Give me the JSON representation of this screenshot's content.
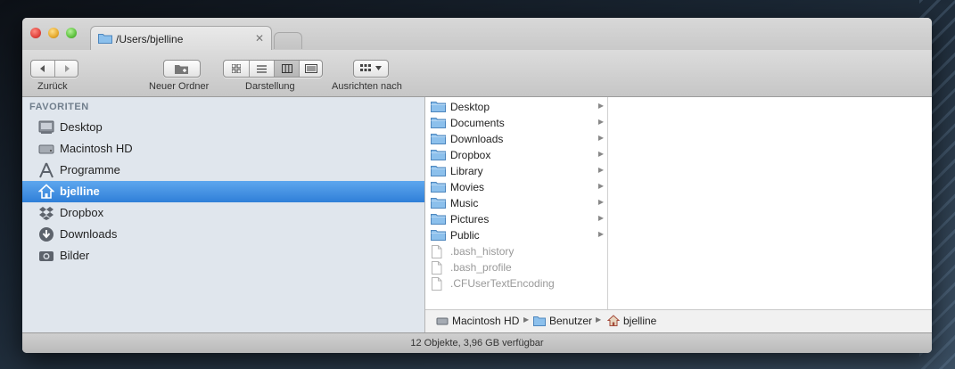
{
  "tab": {
    "title": "/Users/bjelline",
    "close_glyph": "✕"
  },
  "toolbar": {
    "back_label": "Zurück",
    "new_folder_label": "Neuer Ordner",
    "view_label": "Darstellung",
    "arrange_label": "Ausrichten nach",
    "view_modes": [
      "icon",
      "list",
      "column",
      "cover-flow"
    ],
    "active_view": "column"
  },
  "sidebar": {
    "header": "FAVORITEN",
    "items": [
      {
        "label": "Desktop",
        "icon": "desktop-icon",
        "selected": false
      },
      {
        "label": "Macintosh HD",
        "icon": "harddisk-icon",
        "selected": false
      },
      {
        "label": "Programme",
        "icon": "applications-icon",
        "selected": false
      },
      {
        "label": "bjelline",
        "icon": "home-icon",
        "selected": true
      },
      {
        "label": "Dropbox",
        "icon": "dropbox-icon",
        "selected": false
      },
      {
        "label": "Downloads",
        "icon": "downloads-icon",
        "selected": false
      },
      {
        "label": "Bilder",
        "icon": "camera-icon",
        "selected": false
      }
    ]
  },
  "column": {
    "items": [
      {
        "label": "Desktop",
        "type": "folder"
      },
      {
        "label": "Documents",
        "type": "folder"
      },
      {
        "label": "Downloads",
        "type": "folder"
      },
      {
        "label": "Dropbox",
        "type": "folder"
      },
      {
        "label": "Library",
        "type": "folder"
      },
      {
        "label": "Movies",
        "type": "folder"
      },
      {
        "label": "Music",
        "type": "folder"
      },
      {
        "label": "Pictures",
        "type": "folder"
      },
      {
        "label": "Public",
        "type": "folder"
      },
      {
        "label": ".bash_history",
        "type": "file"
      },
      {
        "label": ".bash_profile",
        "type": "file"
      },
      {
        "label": ".CFUserTextEncoding",
        "type": "file"
      }
    ]
  },
  "pathbar": {
    "segments": [
      {
        "label": "Macintosh HD",
        "icon": "harddisk-icon"
      },
      {
        "label": "Benutzer",
        "icon": "folder-icon"
      },
      {
        "label": "bjelline",
        "icon": "home-icon"
      }
    ]
  },
  "status": {
    "text": "12 Objekte, 3,96 GB verfügbar"
  },
  "colors": {
    "selection": "#3b87dc",
    "sidebar_bg": "#e0e6ed",
    "folder": "#7db4e6"
  }
}
